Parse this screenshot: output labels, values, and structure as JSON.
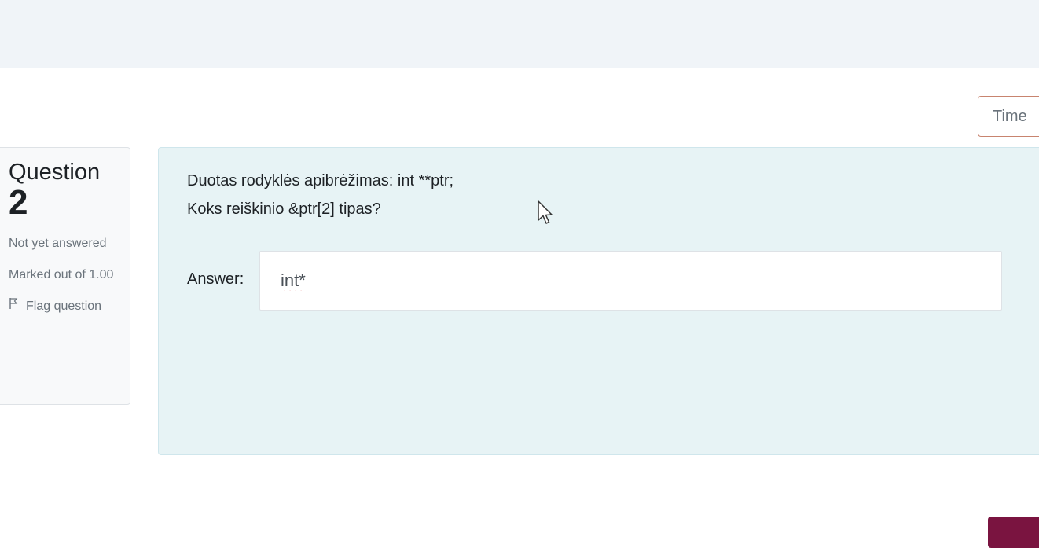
{
  "timer": {
    "label": "Time"
  },
  "question": {
    "label": "Question",
    "number": "2",
    "state": "Not yet answered",
    "grade": "Marked out of 1.00",
    "flag_label": "Flag question",
    "text_lines": [
      "Duotas rodyklės apibrėžimas: int **ptr;",
      "Koks reiškinio &ptr[2] tipas?"
    ],
    "answer_label": "Answer:",
    "answer_value": "int*"
  },
  "icons": {
    "flag": "flag-icon",
    "cursor": "mouse-pointer-icon"
  },
  "colors": {
    "top_band": "#f0f4f8",
    "formulation_bg": "#e7f3f5",
    "info_bg": "#f8f9fa",
    "timer_border": "#c8846f",
    "primary_button": "#7a1440"
  }
}
